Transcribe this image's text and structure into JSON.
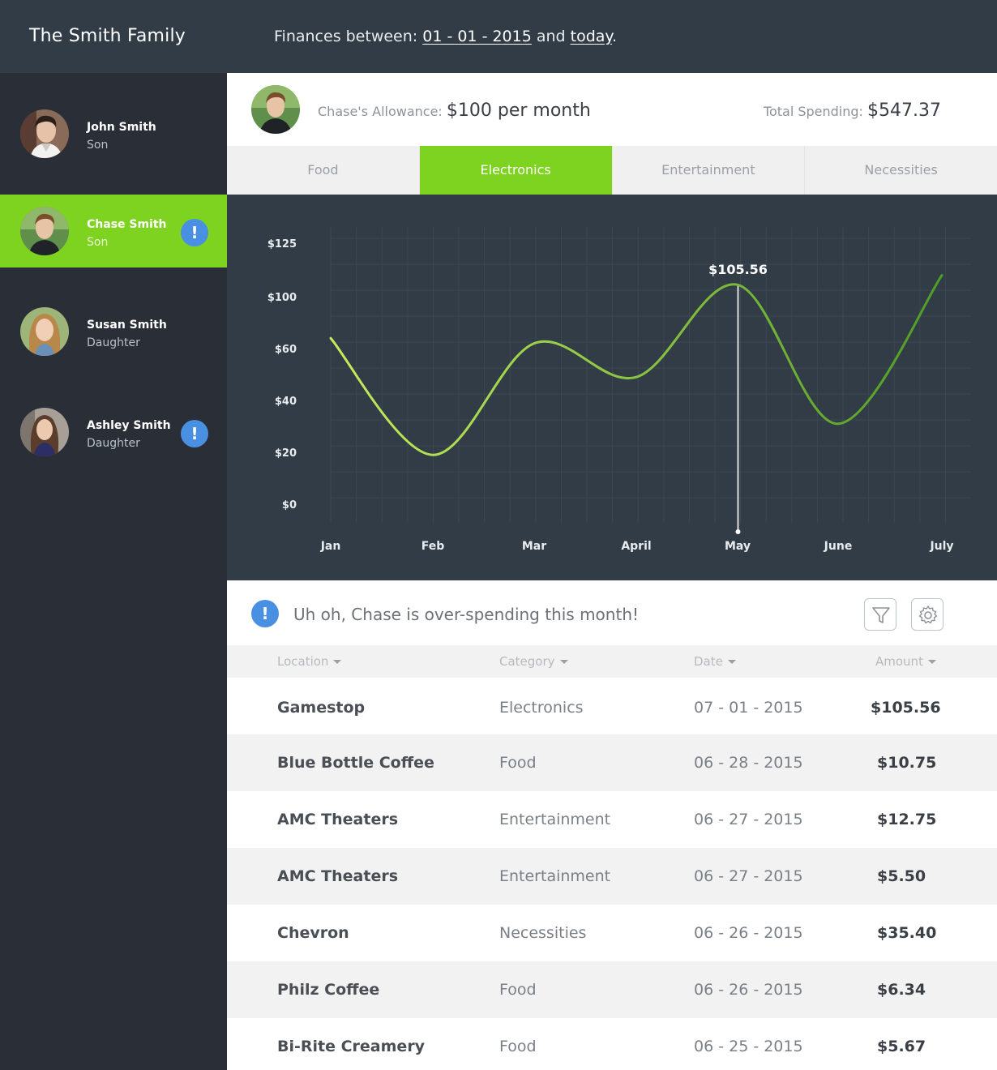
{
  "header": {
    "family_title": "The Smith Family",
    "finances_prefix": "Finances between: ",
    "start_date": "01 - 01 - 2015",
    "and_text": " and ",
    "end_date": "today",
    "period": "."
  },
  "sidebar": {
    "members": [
      {
        "name": "John Smith",
        "role": "Son",
        "alert": false,
        "active": false
      },
      {
        "name": "Chase Smith",
        "role": "Son",
        "alert": true,
        "alert_label": "!",
        "active": true
      },
      {
        "name": "Susan Smith",
        "role": "Daughter",
        "alert": false,
        "active": false
      },
      {
        "name": "Ashley Smith",
        "role": "Daughter",
        "alert": true,
        "alert_label": "!",
        "active": false
      }
    ]
  },
  "profile": {
    "allowance_label": "Chase's Allowance: ",
    "allowance_value": "$100 per month",
    "total_label": "Total Spending: ",
    "total_value": "$547.37"
  },
  "tabs": [
    {
      "label": "Food",
      "active": false
    },
    {
      "label": "Electronics",
      "active": true
    },
    {
      "label": "Entertainment",
      "active": false
    },
    {
      "label": "Necessities",
      "active": false
    }
  ],
  "chart_data": {
    "type": "line",
    "categories": [
      "Jan",
      "Feb",
      "Mar",
      "April",
      "May",
      "June",
      "July"
    ],
    "y_tick_labels": [
      "$0",
      "$20",
      "$40",
      "$60",
      "$100",
      "$125"
    ],
    "series": [
      {
        "values": [
          68,
          19,
          64,
          49,
          105.56,
          31,
          110
        ]
      }
    ],
    "highlight": {
      "category": "May",
      "label": "$105.56"
    },
    "grid": true,
    "colors": {
      "line_start": "#c5ec5c",
      "line_end": "#4f9c27",
      "background": "#323c46",
      "marker": "#d9dde2"
    }
  },
  "alert": {
    "icon_label": "!",
    "message": "Uh oh, Chase is over-spending this month!",
    "filter_icon": "filter-icon",
    "settings_icon": "gear-icon"
  },
  "table": {
    "columns": [
      "Location",
      "Category",
      "Date",
      "Amount"
    ],
    "rows": [
      {
        "location": "Gamestop",
        "category": "Electronics",
        "date": "07 - 01 - 2015",
        "amount": "$105.56"
      },
      {
        "location": "Blue Bottle Coffee",
        "category": "Food",
        "date": "06 - 28 - 2015",
        "amount": "$10.75"
      },
      {
        "location": "AMC Theaters",
        "category": "Entertainment",
        "date": "06 - 27 - 2015",
        "amount": "$12.75"
      },
      {
        "location": "AMC Theaters",
        "category": "Entertainment",
        "date": "06 - 27 - 2015",
        "amount": "$5.50"
      },
      {
        "location": "Chevron",
        "category": "Necessities",
        "date": "06 - 26 - 2015",
        "amount": "$35.40"
      },
      {
        "location": "Philz Coffee",
        "category": "Food",
        "date": "06 - 26 - 2015",
        "amount": "$6.34"
      },
      {
        "location": "Bi-Rite Creamery",
        "category": "Food",
        "date": "06 - 25 - 2015",
        "amount": "$5.67"
      }
    ]
  }
}
